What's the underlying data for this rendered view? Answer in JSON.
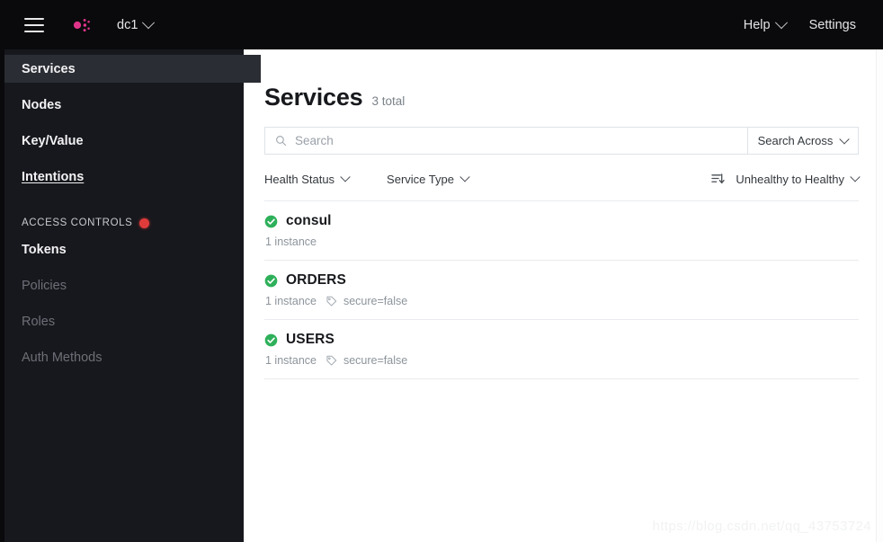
{
  "topnav": {
    "menu_icon": "hamburger-icon",
    "logo_icon": "consul-logo",
    "datacenter": "dc1",
    "help": "Help",
    "settings": "Settings"
  },
  "sidebar": {
    "items": [
      {
        "label": "Services",
        "state": "active"
      },
      {
        "label": "Nodes",
        "state": "normal"
      },
      {
        "label": "Key/Value",
        "state": "normal"
      },
      {
        "label": "Intentions",
        "state": "underlined"
      }
    ],
    "section": {
      "label": "ACCESS CONTROLS",
      "badge_icon": "alert-dot-icon",
      "badge_color": "#e03b3b"
    },
    "acl_items": [
      {
        "label": "Tokens",
        "state": "normal"
      },
      {
        "label": "Policies",
        "state": "dim"
      },
      {
        "label": "Roles",
        "state": "dim"
      },
      {
        "label": "Auth Methods",
        "state": "dim"
      }
    ]
  },
  "main": {
    "title": "Services",
    "total": "3 total",
    "search": {
      "icon": "search-icon",
      "placeholder": "Search",
      "value": "",
      "across_label": "Search Across"
    },
    "filters": {
      "health_status": "Health Status",
      "service_type": "Service Type",
      "sort_icon": "sort-descending-icon",
      "sort_label": "Unhealthy to Healthy"
    },
    "services": [
      {
        "name": "consul",
        "status_icon": "check-circle-icon",
        "status_color": "#2eb05a",
        "instances": "1 instance",
        "tags": []
      },
      {
        "name": "ORDERS",
        "status_icon": "check-circle-icon",
        "status_color": "#2eb05a",
        "instances": "1 instance",
        "tags": [
          {
            "icon": "tag-icon",
            "label": "secure=false"
          }
        ]
      },
      {
        "name": "USERS",
        "status_icon": "check-circle-icon",
        "status_color": "#2eb05a",
        "instances": "1 instance",
        "tags": [
          {
            "icon": "tag-icon",
            "label": "secure=false"
          }
        ]
      }
    ]
  },
  "watermark": "https://blog.csdn.net/qq_43753724"
}
